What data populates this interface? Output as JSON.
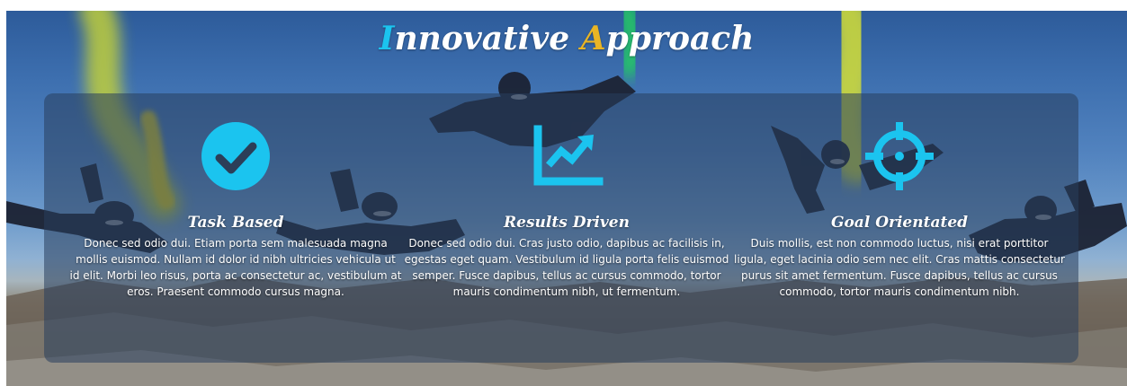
{
  "title": {
    "first_letter": "I",
    "rest_word1": "nnovative ",
    "second_letter": "A",
    "rest_word2": "pproach"
  },
  "colors": {
    "accent_cyan": "#1bc4ef",
    "accent_gold": "#e9b525",
    "text": "#ffffff"
  },
  "features": [
    {
      "icon": "check-circle-icon",
      "title": "Task Based",
      "text": "Donec sed odio dui. Etiam porta sem malesuada magna mollis euismod. Nullam id dolor id nibh ultricies vehicula ut id elit. Morbi leo risus, porta ac consectetur ac, vestibulum at eros. Praesent commodo cursus magna."
    },
    {
      "icon": "line-chart-icon",
      "title": "Results Driven",
      "text": "Donec sed odio dui. Cras justo odio, dapibus ac facilisis in, egestas eget quam. Vestibulum id ligula porta felis euismod semper. Fusce dapibus, tellus ac cursus commodo, tortor mauris condimentum nibh, ut fermentum."
    },
    {
      "icon": "crosshair-target-icon",
      "title": "Goal Orientated",
      "text": "Duis mollis, est non commodo luctus, nisi erat porttitor ligula, eget lacinia odio sem nec elit. Cras mattis consectetur purus sit amet fermentum. Fusce dapibus, tellus ac cursus commodo, tortor mauris condimentum nibh."
    }
  ]
}
